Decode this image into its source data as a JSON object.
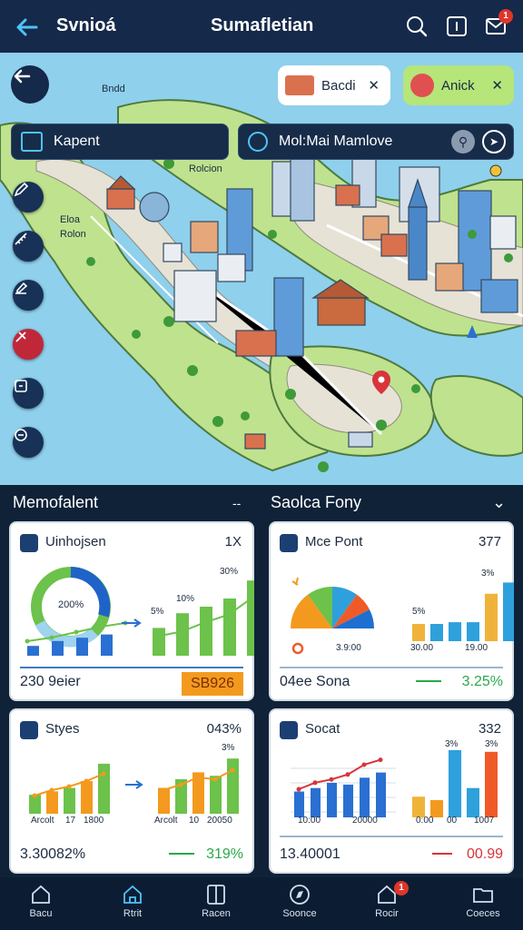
{
  "header": {
    "title_left": "Svnioá",
    "title_center": "Sumafletian",
    "notification_count": "1"
  },
  "map": {
    "chip_left_label": "Kapent",
    "chip_right_label": "Mol:Mai Mamlove",
    "pill_white_label": "Bacdi",
    "pill_green_label": "Anick",
    "labels": [
      "Bndd",
      "Rolcion",
      "Eloa",
      "Rolon"
    ]
  },
  "sections": {
    "left_title": "Memofalent",
    "left_toggle": "--",
    "right_title": "Saolca Fony",
    "right_toggle": "⌄"
  },
  "cards": [
    {
      "title": "Uinhojsen",
      "value": "1X",
      "center_label": "200%",
      "top_label": "30%",
      "small_labels": [
        "5%",
        "10%"
      ],
      "footer_left": "230 9eier",
      "footer_right": "SB926",
      "bars_left": [
        12,
        18,
        22,
        26
      ],
      "bars_right": [
        34,
        52,
        60,
        70,
        92
      ],
      "line_points": [
        30,
        36,
        48,
        58,
        80
      ],
      "colors": {
        "accent": "#f39a1e",
        "green": "#6cc24a",
        "blue": "#2a6fd2"
      }
    },
    {
      "title": "Mce Pont",
      "value": "377",
      "axis_labels": [
        "3.9:00",
        "30.00",
        "19.00"
      ],
      "top_label": "3%",
      "small_labels": [
        "5%"
      ],
      "footer_left": "04ee Sona",
      "footer_right": "3.25%",
      "bars": [
        {
          "value": 20,
          "color": "#f0b33a"
        },
        {
          "value": 20,
          "color": "#2ea0dc"
        },
        {
          "value": 22,
          "color": "#2ea0dc"
        },
        {
          "value": 22,
          "color": "#2ea0dc"
        },
        {
          "value": 55,
          "color": "#f0b33a"
        },
        {
          "value": 68,
          "color": "#2ea0dc"
        }
      ],
      "pie_slices": [
        {
          "value": 30,
          "color": "#f39a1e"
        },
        {
          "value": 20,
          "color": "#6cc24a"
        },
        {
          "value": 20,
          "color": "#2ea0dc"
        },
        {
          "value": 15,
          "color": "#f05a28"
        },
        {
          "value": 15,
          "color": "#1f6fd0"
        }
      ]
    },
    {
      "title": "Styes",
      "value": "043%",
      "axis_labels": [
        "Arcolt",
        "17",
        "1800",
        "Arcolt",
        "10",
        "20050"
      ],
      "top_label": "3%",
      "footer_left": "3.30082%",
      "footer_right": "319%",
      "bars_left": [
        {
          "value": 22,
          "color": "#6cc24a"
        },
        {
          "value": 26,
          "color": "#f39a1e"
        },
        {
          "value": 30,
          "color": "#6cc24a"
        },
        {
          "value": 38,
          "color": "#f39a1e"
        },
        {
          "value": 58,
          "color": "#6cc24a"
        }
      ],
      "bars_right": [
        {
          "value": 30,
          "color": "#f39a1e"
        },
        {
          "value": 40,
          "color": "#6cc24a"
        },
        {
          "value": 48,
          "color": "#f39a1e"
        },
        {
          "value": 44,
          "color": "#6cc24a"
        },
        {
          "value": 64,
          "color": "#6cc24a"
        }
      ]
    },
    {
      "title": "Socat",
      "value": "332",
      "axis_labels": [
        "10:00",
        "20000",
        "0:00",
        "00",
        "1007"
      ],
      "top_labels": [
        "3%",
        "3%"
      ],
      "footer_left": "13.40001",
      "footer_right": "00.99",
      "bars_left": [
        30,
        34,
        40,
        38,
        46,
        52
      ],
      "line_points": [
        30,
        38,
        42,
        48,
        60,
        66
      ],
      "bars_right": [
        {
          "value": 24,
          "color": "#f0b33a"
        },
        {
          "value": 20,
          "color": "#f39a1e"
        },
        {
          "value": 78,
          "color": "#2ea0dc"
        },
        {
          "value": 34,
          "color": "#2ea0dc"
        },
        {
          "value": 76,
          "color": "#f05a28"
        }
      ]
    }
  ],
  "nav": [
    {
      "label": "Bacu",
      "icon": "home-icon"
    },
    {
      "label": "Rtrit",
      "icon": "house-icon"
    },
    {
      "label": "Racen",
      "icon": "book-icon"
    },
    {
      "label": "Soonce",
      "icon": "compass-icon"
    },
    {
      "label": "Rocir",
      "icon": "alert-home-icon",
      "badge": "1"
    },
    {
      "label": "Coeces",
      "icon": "folder-icon"
    }
  ],
  "colors": {
    "header_bg": "#15294a",
    "positive": "#2aa84a",
    "negative": "#d8343a",
    "orange_badge": "#f39a1e"
  }
}
